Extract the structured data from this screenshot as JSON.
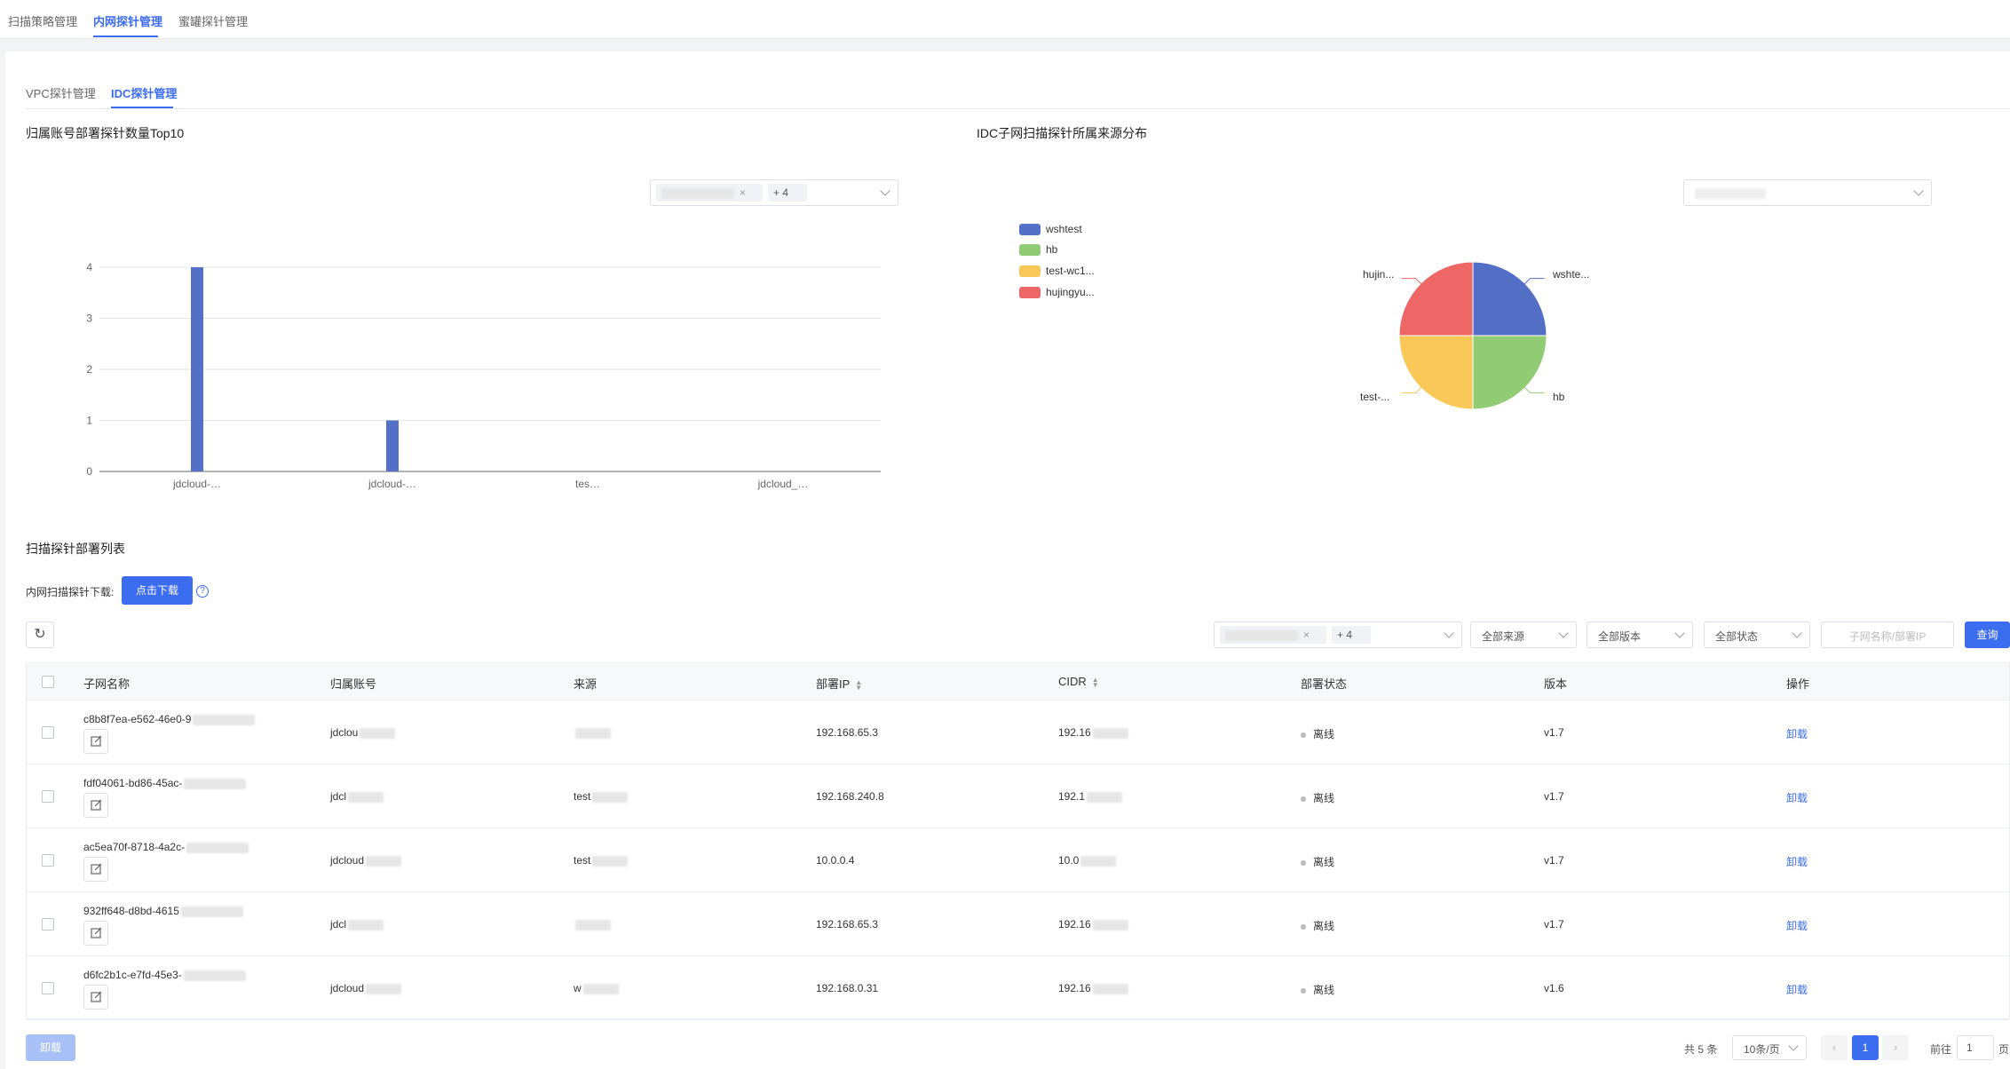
{
  "top_tabs": [
    "扫描策略管理",
    "内网探针管理",
    "蜜罐探针管理"
  ],
  "sub_tabs": [
    "VPC探针管理",
    "IDC探针管理"
  ],
  "bar_section": {
    "title": "归属账号部署探针数量Top10",
    "filter_more": "+ 4"
  },
  "pie_section": {
    "title": "IDC子网扫描探针所属来源分布",
    "legend": [
      "wshtest",
      "hb",
      "test-wc1...",
      "hujingyu..."
    ],
    "labels": [
      "wshte...",
      "hb",
      "test-...",
      "hujin..."
    ]
  },
  "chart_data": [
    {
      "type": "bar",
      "title": "归属账号部署探针数量Top10",
      "categories": [
        "jdcloud-…",
        "jdcloud-…",
        "tes…",
        "jdcloud_…"
      ],
      "values": [
        4,
        1,
        0,
        0
      ],
      "ylim": [
        0,
        4
      ],
      "yticks": [
        "0",
        "1",
        "2",
        "3",
        "4"
      ],
      "color": "#5470c6",
      "grid": true
    },
    {
      "type": "pie",
      "title": "IDC子网扫描探针所属来源分布",
      "slices": [
        {
          "label": "wshtest",
          "value": 1,
          "color": "#5470c6"
        },
        {
          "label": "hb",
          "value": 1,
          "color": "#91cc75"
        },
        {
          "label": "test-wc1...",
          "value": 1,
          "color": "#fac858"
        },
        {
          "label": "hujingyu...",
          "value": 1,
          "color": "#ee6666"
        }
      ],
      "legend_position": "top-left"
    }
  ],
  "list": {
    "title": "扫描探针部署列表",
    "download_label": "内网扫描探针下载:",
    "download_button": "点击下载",
    "filters": {
      "account_more": "+ 4",
      "source": "全部来源",
      "version": "全部版本",
      "status": "全部状态",
      "search_placeholder": "子网名称/部署IP",
      "query_button": "查询"
    },
    "columns": [
      "子网名称",
      "归属账号",
      "来源",
      "部署IP",
      "CIDR",
      "部署状态",
      "版本",
      "操作"
    ],
    "rows": [
      {
        "name": "c8b8f7ea-e562-46e0-9",
        "account": "jdclou",
        "source": "",
        "ip": "192.168.65.3",
        "cidr": "192.16",
        "status": "离线",
        "version": "v1.7",
        "action": "卸载"
      },
      {
        "name": "fdf04061-bd86-45ac-",
        "account": "jdcl",
        "source": "test",
        "ip": "192.168.240.8",
        "cidr": "192.1",
        "status": "离线",
        "version": "v1.7",
        "action": "卸载"
      },
      {
        "name": "ac5ea70f-8718-4a2c-",
        "account": "jdcloud",
        "source": "test",
        "ip": "10.0.0.4",
        "cidr": "10.0",
        "status": "离线",
        "version": "v1.7",
        "action": "卸载"
      },
      {
        "name": "932ff648-d8bd-4615",
        "account": "jdcl",
        "source": "",
        "ip": "192.168.65.3",
        "cidr": "192.16",
        "status": "离线",
        "version": "v1.7",
        "action": "卸载"
      },
      {
        "name": "d6fc2b1c-e7fd-45e3-",
        "account": "jdcloud",
        "source": "w",
        "ip": "192.168.0.31",
        "cidr": "192.16",
        "status": "离线",
        "version": "v1.6",
        "action": "卸载"
      }
    ],
    "bulk_uninstall": "卸载"
  },
  "pagination": {
    "total": "共 5 条",
    "page_size": "10条/页",
    "current_page": "1",
    "goto_label": "前往",
    "goto_value": "1",
    "goto_suffix": "页"
  }
}
